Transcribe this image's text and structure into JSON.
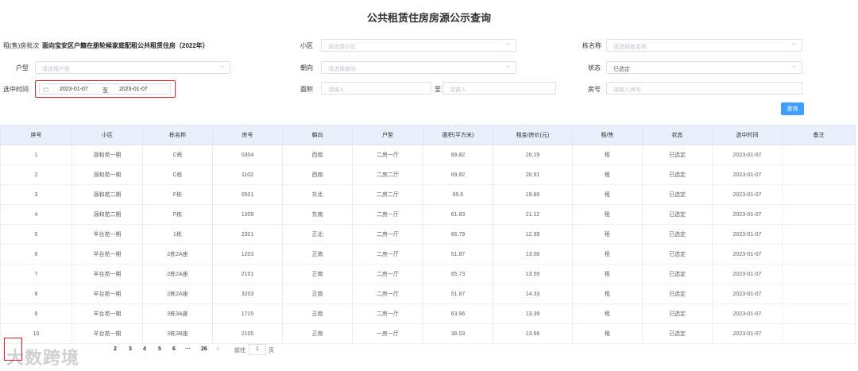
{
  "page_title": "公共租赁住房房源公示查询",
  "filters": {
    "batch_label": "租(售)房批次",
    "batch_value": "面向宝安区户籍在册轮候家庭配租公共租赁住房（2022年）",
    "community_label": "小区",
    "community_placeholder": "请选择小区",
    "building_label": "栋名称",
    "building_placeholder": "请选择栋名称",
    "type_label": "户型",
    "type_placeholder": "请选择户型",
    "orientation_label": "朝向",
    "orientation_placeholder": "请选择朝向",
    "status_label": "状态",
    "status_value": "已选定",
    "time_label": "选中时间",
    "date_from": "2023-01-07",
    "date_sep": "至",
    "date_to": "2023-01-07",
    "area_label": "面积",
    "area_from_placeholder": "请输入",
    "area_sep": "至",
    "area_to_placeholder": "请输入",
    "room_label": "房号",
    "room_placeholder": "请输入房号",
    "query_button": "查询"
  },
  "table": {
    "headers": [
      "序号",
      "小区",
      "栋名称",
      "房号",
      "朝向",
      "户型",
      "面积(平方米)",
      "租金/房价(元)",
      "租/售",
      "状态",
      "选中时间",
      "备注"
    ],
    "rows": [
      [
        "1",
        "源和苑一期",
        "C栋",
        "0304",
        "西南",
        "二房一厅",
        "69.82",
        "20.19",
        "租",
        "已选定",
        "2023-01-07",
        ""
      ],
      [
        "2",
        "源和苑一期",
        "C栋",
        "1102",
        "西南",
        "二房二厅",
        "69.82",
        "20.91",
        "租",
        "已选定",
        "2023-01-07",
        ""
      ],
      [
        "3",
        "源和苑二期",
        "F栋",
        "0501",
        "东北",
        "二房二厅",
        "69.6",
        "19.89",
        "租",
        "已选定",
        "2023-01-07",
        ""
      ],
      [
        "4",
        "源和苑二期",
        "F栋",
        "1009",
        "东南",
        "二房一厅",
        "61.83",
        "21.12",
        "租",
        "已选定",
        "2023-01-07",
        ""
      ],
      [
        "5",
        "羊台苑一期",
        "1栋",
        "2301",
        "正北",
        "二房一厅",
        "66.79",
        "12.99",
        "租",
        "已选定",
        "2023-01-07",
        ""
      ],
      [
        "6",
        "羊台苑一期",
        "2栋2A座",
        "1203",
        "正南",
        "二房一厅",
        "51.87",
        "13.06",
        "租",
        "已选定",
        "2023-01-07",
        ""
      ],
      [
        "7",
        "羊台苑一期",
        "2栋2A座",
        "2101",
        "正南",
        "二房一厅",
        "65.73",
        "13.59",
        "租",
        "已选定",
        "2023-01-07",
        ""
      ],
      [
        "8",
        "羊台苑一期",
        "2栋2A座",
        "3203",
        "正南",
        "二房一厅",
        "51.87",
        "14.33",
        "租",
        "已选定",
        "2023-01-07",
        ""
      ],
      [
        "9",
        "羊台苑一期",
        "3栋3A座",
        "1715",
        "正南",
        "二房一厅",
        "63.96",
        "13.39",
        "租",
        "已选定",
        "2023-01-07",
        ""
      ],
      [
        "10",
        "羊台苑一期",
        "3栋3B座",
        "2105",
        "正南",
        "一房一厅",
        "36.03",
        "13.66",
        "租",
        "已选定",
        "2023-01-07",
        ""
      ]
    ]
  },
  "pagination": {
    "pages": [
      "2",
      "3",
      "4",
      "5",
      "6"
    ],
    "ellipsis": "···",
    "last": "26",
    "next": "›",
    "goto_label": "前往",
    "goto_value": "1",
    "page_suffix": "页"
  },
  "watermark": "大数跨境",
  "colors": {
    "accent": "#409eff",
    "highlight": "#e02020",
    "header_bg": "#e8f0fc"
  }
}
